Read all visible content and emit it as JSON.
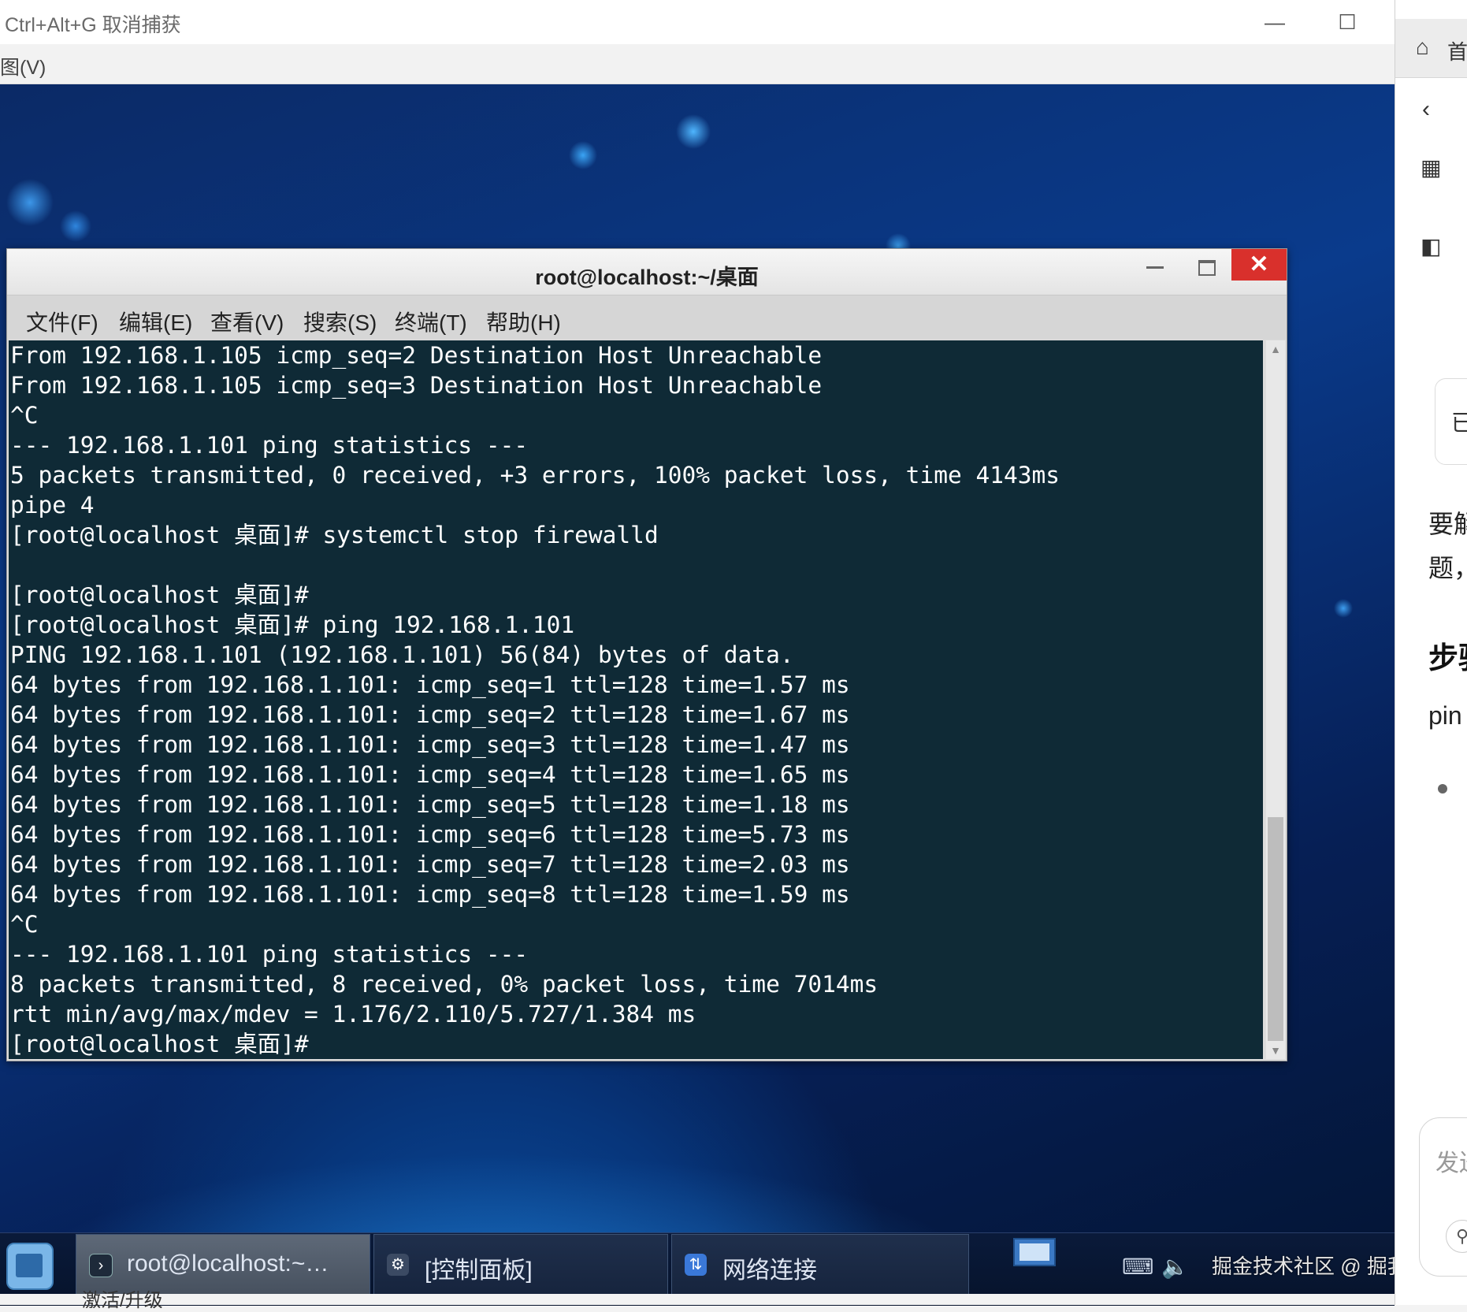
{
  "host": {
    "title": "Ctrl+Alt+G 取消捕获",
    "menu_view": "图(V)",
    "minimize": "—",
    "maximize": "☐",
    "close": "✕"
  },
  "terminal": {
    "title": "root@localhost:~/桌面",
    "close": "✕",
    "menu": [
      "文件(F)",
      "编辑(E)",
      "查看(V)",
      "搜索(S)",
      "终端(T)",
      "帮助(H)"
    ],
    "lines": [
      "From 192.168.1.105 icmp_seq=2 Destination Host Unreachable",
      "From 192.168.1.105 icmp_seq=3 Destination Host Unreachable",
      "^C",
      "--- 192.168.1.101 ping statistics ---",
      "5 packets transmitted, 0 received, +3 errors, 100% packet loss, time 4143ms",
      "pipe 4",
      "[root@localhost 桌面]# systemctl stop firewalld",
      "",
      "[root@localhost 桌面]#",
      "[root@localhost 桌面]# ping 192.168.1.101",
      "PING 192.168.1.101 (192.168.1.101) 56(84) bytes of data.",
      "64 bytes from 192.168.1.101: icmp_seq=1 ttl=128 time=1.57 ms",
      "64 bytes from 192.168.1.101: icmp_seq=2 ttl=128 time=1.67 ms",
      "64 bytes from 192.168.1.101: icmp_seq=3 ttl=128 time=1.47 ms",
      "64 bytes from 192.168.1.101: icmp_seq=4 ttl=128 time=1.65 ms",
      "64 bytes from 192.168.1.101: icmp_seq=5 ttl=128 time=1.18 ms",
      "64 bytes from 192.168.1.101: icmp_seq=6 ttl=128 time=5.73 ms",
      "64 bytes from 192.168.1.101: icmp_seq=7 ttl=128 time=2.03 ms",
      "64 bytes from 192.168.1.101: icmp_seq=8 ttl=128 time=1.59 ms",
      "^C",
      "--- 192.168.1.101 ping statistics ---",
      "8 packets transmitted, 8 received, 0% packet loss, time 7014ms",
      "rtt min/avg/max/mdev = 1.176/2.110/5.727/1.384 ms",
      "[root@localhost 桌面]#"
    ]
  },
  "taskbar": {
    "items": [
      {
        "label": "root@localhost:~…",
        "icon": "terminal-icon"
      },
      {
        "label": "[控制面板]",
        "icon": "gear-icon"
      },
      {
        "label": "网络连接",
        "icon": "network-icon"
      }
    ],
    "watermark": "掘金技术社区 @ 掘我的金",
    "below_text": "激活/升级"
  },
  "side_panel": {
    "tab_label": "首",
    "card_text": "已",
    "text_1": "要解",
    "text_2": "题，",
    "heading": "步骤",
    "text_3": "pin",
    "input_placeholder": "发送"
  },
  "colors": {
    "terminal_bg": "#0f2a36",
    "terminal_fg": "#ffffff",
    "close_red": "#d9302c"
  }
}
